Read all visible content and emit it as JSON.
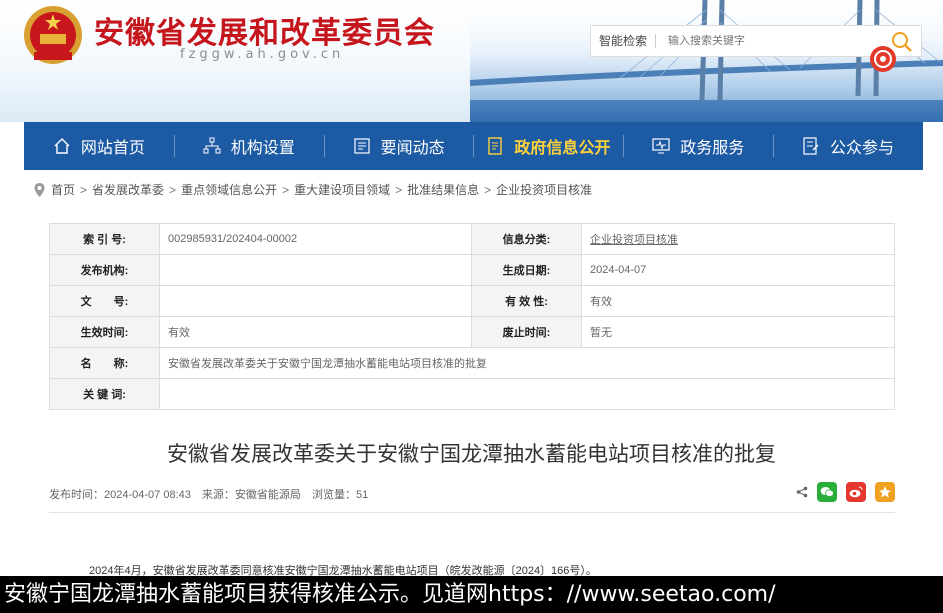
{
  "header": {
    "site_title": "安徽省发展和改革委员会",
    "site_domain": "fzggw.ah.gov.cn",
    "search": {
      "label": "智能检索",
      "placeholder": "输入搜索关键字"
    }
  },
  "nav": {
    "items": [
      {
        "label": "网站首页",
        "icon": "home-icon"
      },
      {
        "label": "机构设置",
        "icon": "org-chart-icon"
      },
      {
        "label": "要闻动态",
        "icon": "news-icon"
      },
      {
        "label": "政府信息公开",
        "icon": "document-icon",
        "active": true
      },
      {
        "label": "政务服务",
        "icon": "monitor-icon"
      },
      {
        "label": "公众参与",
        "icon": "form-icon"
      }
    ]
  },
  "breadcrumb": [
    "首页",
    "省发展改革委",
    "重点领域信息公开",
    "重大建设项目领域",
    "批准结果信息",
    "企业投资项目核准"
  ],
  "info": {
    "index_label": "索 引 号:",
    "index_value": "002985931/202404-00002",
    "category_label": "信息分类:",
    "category_value": "企业投资项目核准",
    "publisher_label": "发布机构:",
    "publisher_value": "",
    "date_label": "生成日期:",
    "date_value": "2024-04-07",
    "doc_no_label": "文　　号:",
    "doc_no_value": "",
    "validity_label": "有 效 性:",
    "validity_value": "有效",
    "effective_label": "生效时间:",
    "effective_value": "有效",
    "abolish_label": "废止时间:",
    "abolish_value": "暂无",
    "name_label": "名　　称:",
    "name_value": "安徽省发展改革委关于安徽宁国龙潭抽水蓄能电站项目核准的批复",
    "keywords_label": "关 键 词:",
    "keywords_value": ""
  },
  "article": {
    "title": "安徽省发展改革委关于安徽宁国龙潭抽水蓄能电站项目核准的批复",
    "publish_time": "发布时间：2024-04-07 08:43",
    "source": "来源：安徽省能源局",
    "views": "浏览量：51",
    "body": "2024年4月，安徽省发展改革委同意核准安徽宁国龙潭抽水蓄能电站项目（皖发改能源〔2024〕166号）。"
  },
  "caption": "安徽宁国龙潭抽水蓄能项目获得核准公示。见道网https：//www.seetao.com/",
  "colors": {
    "nav_bg": "#1c5aa4",
    "nav_active": "#ffd23a",
    "title_red": "#c4161c"
  }
}
